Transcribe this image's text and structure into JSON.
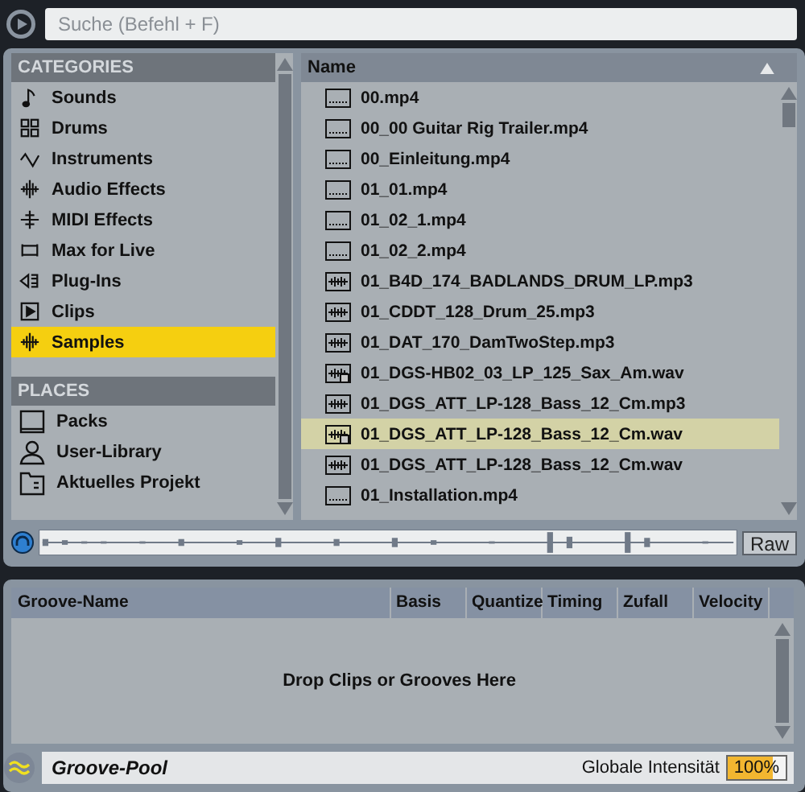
{
  "search": {
    "placeholder": "Suche (Befehl + F)"
  },
  "categories": {
    "title": "CATEGORIES",
    "items": [
      {
        "kind": "note",
        "label": "Sounds",
        "selected": false
      },
      {
        "kind": "grid",
        "label": "Drums",
        "selected": false
      },
      {
        "kind": "wave",
        "label": "Instruments",
        "selected": false
      },
      {
        "kind": "audiofx",
        "label": "Audio Effects",
        "selected": false
      },
      {
        "kind": "midifx",
        "label": "MIDI Effects",
        "selected": false
      },
      {
        "kind": "max",
        "label": "Max for Live",
        "selected": false
      },
      {
        "kind": "plug",
        "label": "Plug-Ins",
        "selected": false
      },
      {
        "kind": "clip",
        "label": "Clips",
        "selected": false
      },
      {
        "kind": "sample",
        "label": "Samples",
        "selected": true
      }
    ]
  },
  "places": {
    "title": "PLACES",
    "items": [
      {
        "kind": "pack",
        "label": "Packs"
      },
      {
        "kind": "user",
        "label": "User-Library"
      },
      {
        "kind": "folder",
        "label": "Aktuelles Projekt"
      }
    ]
  },
  "files": {
    "column": "Name",
    "rows": [
      {
        "kind": "video",
        "name": "00.mp4",
        "selected": false
      },
      {
        "kind": "video",
        "name": "00_00 Guitar Rig Trailer.mp4",
        "selected": false
      },
      {
        "kind": "video",
        "name": "00_Einleitung.mp4",
        "selected": false
      },
      {
        "kind": "video",
        "name": "01_01.mp4",
        "selected": false
      },
      {
        "kind": "video",
        "name": "01_02_1.mp4",
        "selected": false
      },
      {
        "kind": "video",
        "name": "01_02_2.mp4",
        "selected": false
      },
      {
        "kind": "audio",
        "name": "01_B4D_174_BADLANDS_DRUM_LP.mp3",
        "selected": false
      },
      {
        "kind": "audio",
        "name": "01_CDDT_128_Drum_25.mp3",
        "selected": false
      },
      {
        "kind": "audio",
        "name": "01_DAT_170_DamTwoStep.mp3",
        "selected": false
      },
      {
        "kind": "analyzed",
        "name": "01_DGS-HB02_03_LP_125_Sax_Am.wav",
        "selected": false
      },
      {
        "kind": "audio",
        "name": "01_DGS_ATT_LP-128_Bass_12_Cm.mp3",
        "selected": false
      },
      {
        "kind": "analyzed",
        "name": "01_DGS_ATT_LP-128_Bass_12_Cm.wav",
        "selected": true
      },
      {
        "kind": "audio",
        "name": "01_DGS_ATT_LP-128_Bass_12_Cm.wav",
        "selected": false
      },
      {
        "kind": "video",
        "name": "01_Installation.mp4",
        "selected": false
      }
    ]
  },
  "preview": {
    "raw_button": "Raw"
  },
  "groove_pool": {
    "columns": [
      "Groove-Name",
      "Basis",
      "Quantize",
      "Timing",
      "Zufall",
      "Velocity"
    ],
    "empty_message": "Drop Clips or Grooves Here",
    "title": "Groove-Pool",
    "intensity_label": "Globale Intensität",
    "intensity_value": "100%",
    "level": 0.78
  }
}
